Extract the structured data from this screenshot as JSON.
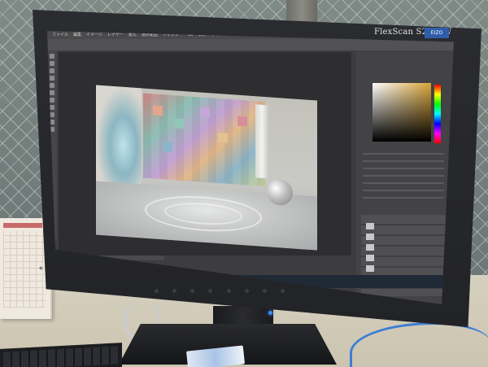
{
  "monitor": {
    "model_label": "FlexScan S2431W",
    "logo_label": "EIZO"
  },
  "app": {
    "menu_items": [
      "ファイル",
      "編集",
      "イメージ",
      "レイヤー",
      "書式",
      "選択範囲",
      "フィルター",
      "3D",
      "表示",
      "ウィンドウ",
      "ヘルプ"
    ]
  },
  "colors": {
    "accent_blue": "#3c8bff",
    "brand_blue": "#2f5dab",
    "ui_dark": "#3d3d3f"
  }
}
